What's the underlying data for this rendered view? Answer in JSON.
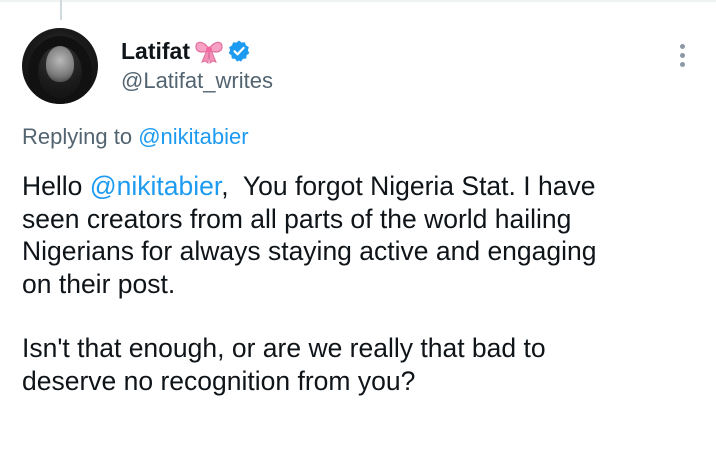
{
  "tweet": {
    "author": {
      "display_name": "Latifat",
      "handle": "@Latifat_writes",
      "verified": true,
      "name_emoji_icon": "ribbon-bow-icon"
    },
    "replying_to": {
      "prefix": "Replying to",
      "mention": "@nikitabier"
    },
    "body": {
      "p1_greeting": "Hello ",
      "p1_mention": "@nikitabier",
      "p1_line1_rest": ",  You forgot Nigeria Stat. I have",
      "p1_line2": "seen creators from all parts of the world hailing",
      "p1_line3": "Nigerians for always staying active and engaging",
      "p1_line4": "on their post.",
      "p2_line1": "Isn't that enough, or are we really that bad to",
      "p2_line2": "deserve no recognition from you?"
    }
  },
  "colors": {
    "link": "#1d9bf0",
    "secondary_text": "#536471",
    "primary_text": "#0f1419",
    "verified_badge": "#1d9bf0",
    "bow": "#f7a1c4"
  }
}
